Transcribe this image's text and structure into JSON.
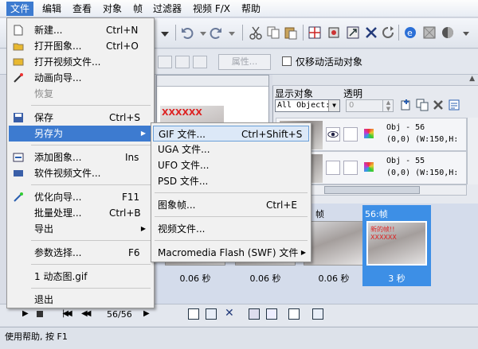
{
  "menubar": {
    "file": "文件",
    "edit": "编辑",
    "view": "查看",
    "object": "对象",
    "frame": "帧",
    "filter": "过滤器",
    "video_fx": "视频 F/X",
    "help": "帮助"
  },
  "toolbar2": {
    "properties": "属性...",
    "move_active_only": "仅移动活动对象"
  },
  "frame_panel": {
    "preview_text": "XXXXXX"
  },
  "object_panel": {
    "show_objects_label": "显示对象",
    "opacity_label": "透明",
    "filter_value": "All Object:",
    "opacity_value": "0",
    "rows": [
      {
        "line1": "Obj - 56",
        "line2": "(0,0) (W:150,H:"
      },
      {
        "line1": "Obj - 55",
        "line2": "(0,0) (W:150,H:"
      }
    ]
  },
  "frames": [
    {
      "label": "",
      "delay": "0.06 秒"
    },
    {
      "label": "",
      "delay": "0.06 秒"
    },
    {
      "label": "帧",
      "delay": "0.06 秒"
    },
    {
      "label": "56:帧",
      "delay": "3 秒",
      "caption": "新的帧!! XXXXXX"
    }
  ],
  "playback": {
    "page_count": "56/56"
  },
  "status": {
    "text": "使用帮助, 按 F1"
  },
  "file_menu": {
    "items": [
      {
        "label": "新建...",
        "shortcut": "Ctrl+N"
      },
      {
        "label": "打开图象...",
        "shortcut": "Ctrl+O"
      },
      {
        "label": "打开视频文件..."
      },
      {
        "label": "动画向导..."
      },
      {
        "label": "恢复"
      },
      {
        "label": "保存",
        "shortcut": "Ctrl+S"
      },
      {
        "label": "另存为"
      },
      {
        "label": "添加图象...",
        "shortcut": "Ins"
      },
      {
        "label": "软件视频文件..."
      },
      {
        "label": "优化向导...",
        "shortcut": "F11"
      },
      {
        "label": "批量处理...",
        "shortcut": "Ctrl+B"
      },
      {
        "label": "导出"
      },
      {
        "label": "参数选择...",
        "shortcut": "F6"
      },
      {
        "label": "1 动态图.gif"
      },
      {
        "label": "退出"
      }
    ]
  },
  "saveas_menu": {
    "items": [
      {
        "label": "GIF 文件...",
        "shortcut": "Ctrl+Shift+S"
      },
      {
        "label": "UGA 文件..."
      },
      {
        "label": "UFO 文件..."
      },
      {
        "label": "PSD 文件..."
      },
      {
        "label": "图象帧...",
        "shortcut": "Ctrl+E"
      },
      {
        "label": "视频文件..."
      },
      {
        "label": "Macromedia Flash (SWF) 文件"
      }
    ]
  }
}
